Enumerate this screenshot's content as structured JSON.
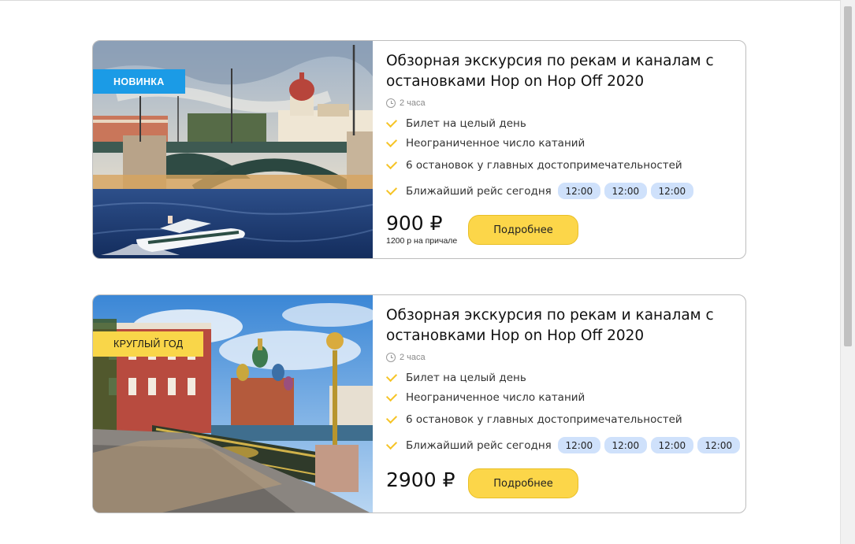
{
  "tours": [
    {
      "badge": "Новинка",
      "title": "Обзорная экскурсия по рекам и каналам с остановками Hop on Hop Off 2020",
      "duration": "2 часа",
      "features": [
        "Билет на целый день",
        "Неограниченное число катаний",
        "6 остановок у главных достопримечательностей"
      ],
      "departures_label": "Ближайший рейс сегодня",
      "times": [
        "12:00",
        "12:00",
        "12:00"
      ],
      "price": "900 ₽",
      "price_note": "1200 р на причале",
      "button": "Подробнее",
      "image": "bridge-with-speedboat-photo"
    },
    {
      "badge": "Круглый год",
      "title": "Обзорная экскурсия по рекам и каналам с остановками Hop on Hop Off 2020",
      "duration": "2 часа",
      "features": [
        "Билет на целый день",
        "Неограниченное число катаний",
        "6 остановок у главных достопримечательностей"
      ],
      "departures_label": "Ближайший рейс сегодня",
      "times": [
        "12:00",
        "12:00",
        "12:00",
        "12:00"
      ],
      "price": "2900 ₽",
      "button": "Подробнее",
      "image": "church-and-canal-photo"
    }
  ],
  "colors": {
    "badge_new": "#1b9be6",
    "badge_year": "#f9d649",
    "button": "#fcd649",
    "check": "#f6c427",
    "time_chip": "#cfe1fb"
  }
}
